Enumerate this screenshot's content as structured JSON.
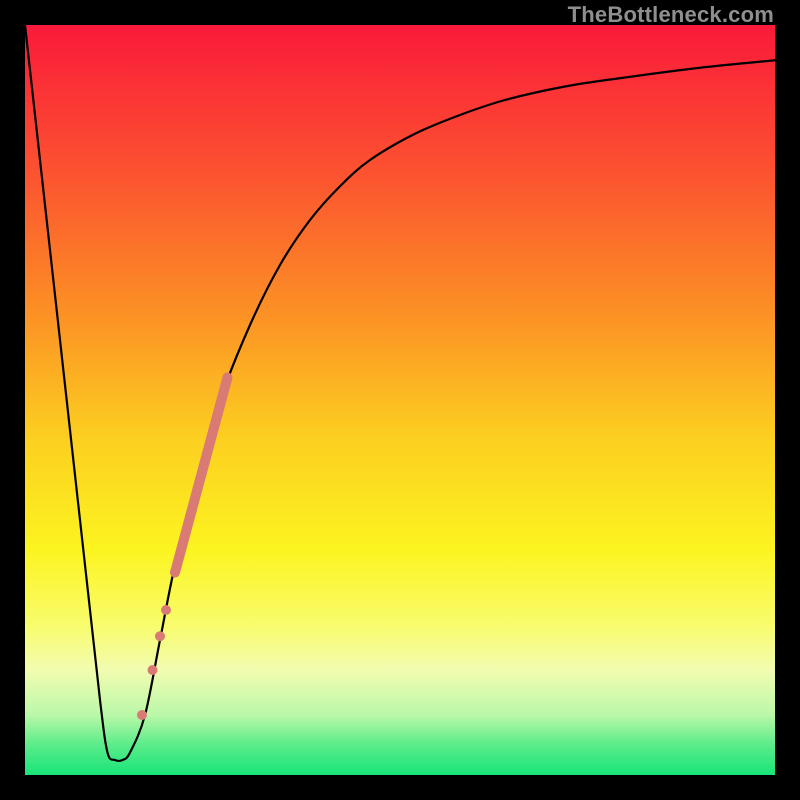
{
  "watermark": "TheBottleneck.com",
  "chart_data": {
    "type": "line",
    "title": "",
    "xlabel": "",
    "ylabel": "",
    "xlim": [
      0,
      100
    ],
    "ylim": [
      0,
      100
    ],
    "background_gradient": {
      "stops": [
        {
          "offset": 0.0,
          "color": "#fa1a3a"
        },
        {
          "offset": 0.2,
          "color": "#fc5330"
        },
        {
          "offset": 0.4,
          "color": "#fc9624"
        },
        {
          "offset": 0.55,
          "color": "#fccf20"
        },
        {
          "offset": 0.7,
          "color": "#fcf420"
        },
        {
          "offset": 0.8,
          "color": "#f8fc6c"
        },
        {
          "offset": 0.86,
          "color": "#f2fcb0"
        },
        {
          "offset": 0.92,
          "color": "#baf8a8"
        },
        {
          "offset": 0.96,
          "color": "#5aec8a"
        },
        {
          "offset": 1.0,
          "color": "#18e478"
        }
      ]
    },
    "series": [
      {
        "name": "bottleneck-curve",
        "x": [
          0,
          4,
          8,
          10,
          11,
          12,
          13,
          14,
          16,
          18,
          20,
          23,
          26,
          30,
          34,
          38,
          42,
          46,
          52,
          58,
          64,
          72,
          80,
          90,
          100
        ],
        "y": [
          100,
          64,
          28,
          10,
          3,
          2,
          2,
          3,
          8,
          18,
          28,
          40,
          50,
          60,
          68,
          74,
          78.5,
          82,
          85.5,
          88,
          90,
          91.8,
          93,
          94.3,
          95.3
        ]
      }
    ],
    "markers": [
      {
        "name": "segment-band",
        "kind": "thick-line",
        "x": [
          20.0,
          27.0
        ],
        "y": [
          27,
          53
        ],
        "color": "#d97a75",
        "width": 10
      },
      {
        "name": "dot1",
        "kind": "circle",
        "x": 18.8,
        "y": 22.0,
        "r": 5,
        "color": "#d97a75"
      },
      {
        "name": "dot2",
        "kind": "circle",
        "x": 18.0,
        "y": 18.5,
        "r": 5,
        "color": "#d97a75"
      },
      {
        "name": "dot3",
        "kind": "circle",
        "x": 17.0,
        "y": 14.0,
        "r": 5,
        "color": "#d97a75"
      },
      {
        "name": "dot4",
        "kind": "circle",
        "x": 15.6,
        "y": 8.0,
        "r": 5,
        "color": "#d97a75"
      }
    ]
  }
}
